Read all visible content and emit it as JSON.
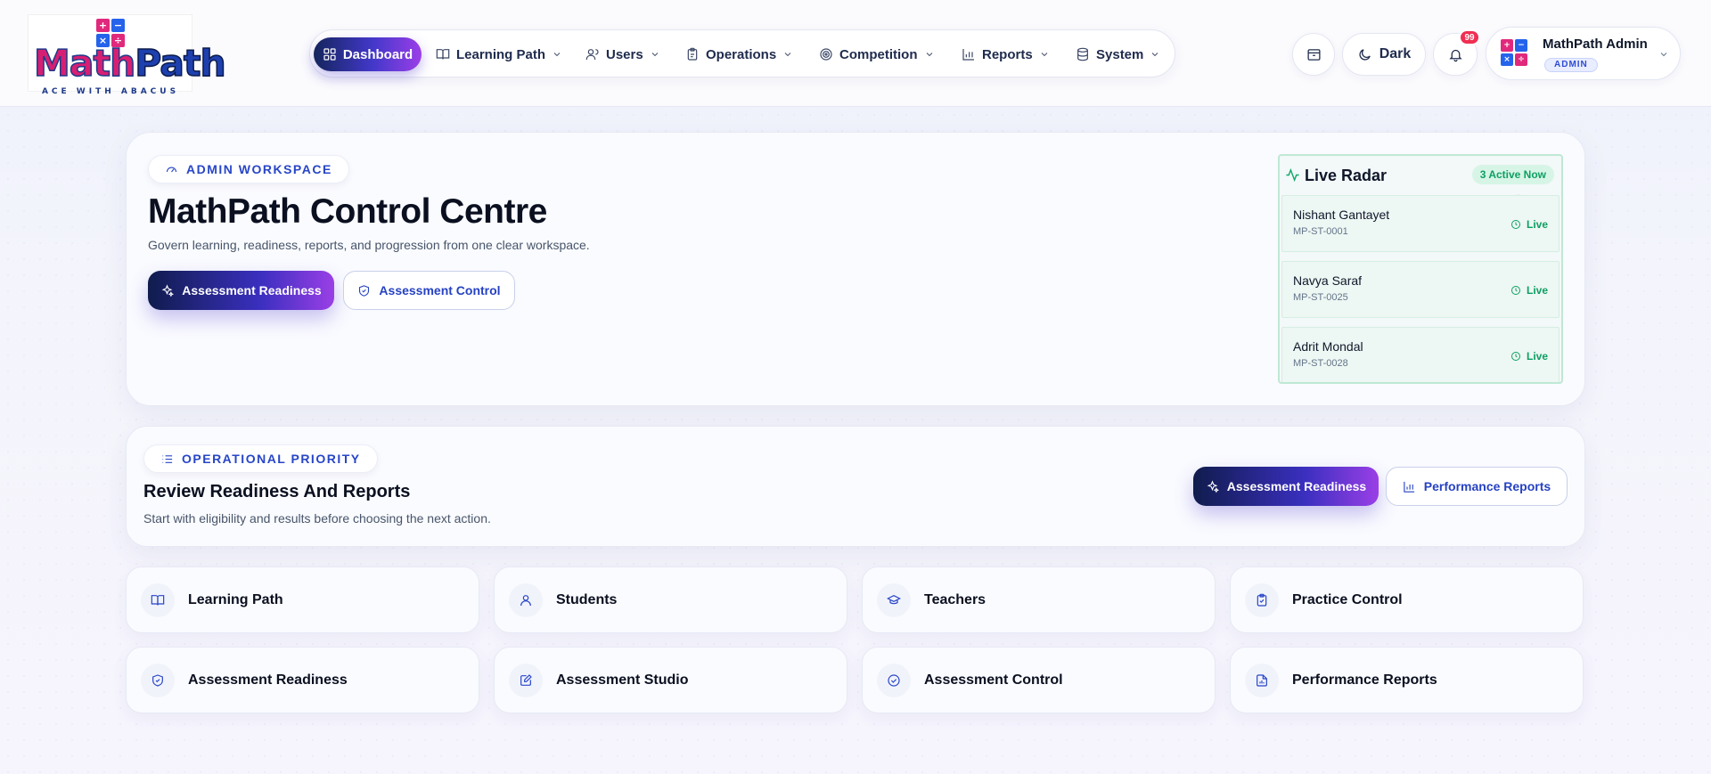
{
  "app": {
    "logo_word": "MathPath",
    "logo_tagline": "ACE WITH ABACUS",
    "logo_tiles": [
      "+",
      "−",
      "×",
      "÷"
    ]
  },
  "nav": [
    {
      "label": "Dashboard",
      "icon": "dashboard-grid-icon",
      "active": true
    },
    {
      "label": "Learning Path",
      "icon": "book-open-icon"
    },
    {
      "label": "Users",
      "icon": "users-icon"
    },
    {
      "label": "Operations",
      "icon": "clipboard-icon"
    },
    {
      "label": "Competition",
      "icon": "target-icon"
    },
    {
      "label": "Reports",
      "icon": "bar-chart-icon"
    },
    {
      "label": "System",
      "icon": "database-icon"
    }
  ],
  "header": {
    "theme_label": "Dark",
    "notification_count": "99",
    "user_name": "MathPath Admin",
    "user_role": "ADMIN"
  },
  "hero": {
    "workspace_label": "ADMIN WORKSPACE",
    "title": "MathPath Control Centre",
    "subtitle": "Govern learning, readiness, reports, and progression from one clear workspace.",
    "primary_button": "Assessment Readiness",
    "secondary_button": "Assessment Control"
  },
  "radar": {
    "title": "Live Radar",
    "active_badge": "3 Active Now",
    "students": [
      {
        "name": "Nishant Gantayet",
        "id": "MP-ST-0001",
        "status": "Live"
      },
      {
        "name": "Navya Saraf",
        "id": "MP-ST-0025",
        "status": "Live"
      },
      {
        "name": "Adrit Mondal",
        "id": "MP-ST-0028",
        "status": "Live"
      }
    ]
  },
  "priority": {
    "label": "OPERATIONAL PRIORITY",
    "title": "Review Readiness And Reports",
    "subtitle": "Start with eligibility and results before choosing the next action.",
    "primary_button": "Assessment Readiness",
    "secondary_button": "Performance Reports"
  },
  "tiles": [
    {
      "label": "Learning Path",
      "icon": "book-open-icon"
    },
    {
      "label": "Students",
      "icon": "user-icon"
    },
    {
      "label": "Teachers",
      "icon": "graduation-cap-icon"
    },
    {
      "label": "Practice Control",
      "icon": "clipboard-check-icon"
    },
    {
      "label": "Assessment Readiness",
      "icon": "shield-check-icon"
    },
    {
      "label": "Assessment Studio",
      "icon": "edit-icon"
    },
    {
      "label": "Assessment Control",
      "icon": "check-circle-icon"
    },
    {
      "label": "Performance Reports",
      "icon": "file-report-icon"
    }
  ],
  "colors": {
    "accent": "#2846c7",
    "gradient_start": "#101c4d",
    "gradient_end": "#9a3fe6",
    "live_green": "#0e9f63",
    "notification_red": "#ef2f52"
  }
}
